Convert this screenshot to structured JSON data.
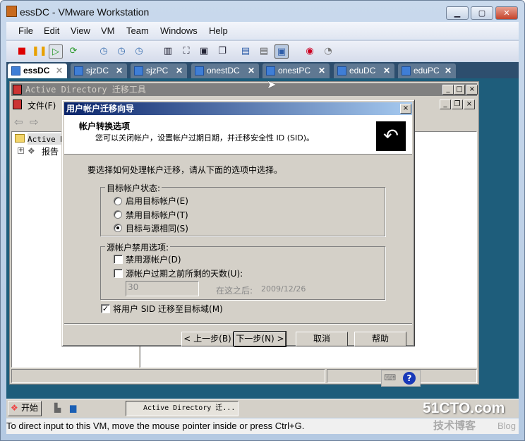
{
  "window": {
    "title": "essDC - VMware Workstation",
    "minimize": "▁",
    "maximize": "▢",
    "close": "✕"
  },
  "menu": [
    "File",
    "Edit",
    "View",
    "VM",
    "Team",
    "Windows",
    "Help"
  ],
  "toolbar_icons": [
    "stop-icon",
    "pause-icon",
    "play-icon",
    "reset-icon",
    "snapshot-icon",
    "revert-snapshot-icon",
    "snapshot-manager-icon",
    "sidebar-icon",
    "quick-switch-icon",
    "fullscreen-icon",
    "unity-icon",
    "summary-icon",
    "console-icon",
    "console-view-icon",
    "record-icon",
    "replay-icon"
  ],
  "tabs": [
    {
      "label": "essDC",
      "active": true
    },
    {
      "label": "sjzDC"
    },
    {
      "label": "sjzPC"
    },
    {
      "label": "onestDC"
    },
    {
      "label": "onestPC"
    },
    {
      "label": "eduDC"
    },
    {
      "label": "eduPC"
    }
  ],
  "tab_close": "✕",
  "ad_window": {
    "title": "Active Directory 迁移工具",
    "menu_file": "文件(F)",
    "tree_root": "Active Directory 迁移工具",
    "tree_child": "报告",
    "expand": "+"
  },
  "dialog": {
    "title": "用户帐户迁移向导",
    "header_title": "帐户转换选项",
    "header_subtitle": "您可以关闭帐户，设置帐户过期日期，并迁移安全性 ID (SID)。",
    "instruction": "要选择如何处理帐户迁移，请从下面的选项中选择。",
    "group1": {
      "label": "目标帐户状态:",
      "options": [
        {
          "label": "启用目标帐户(E)",
          "selected": false
        },
        {
          "label": "禁用目标帐户(T)",
          "selected": false
        },
        {
          "label": "目标与源相同(S)",
          "selected": true
        }
      ]
    },
    "group2": {
      "label": "源帐户禁用选项:",
      "disable_source": {
        "label": "禁用源帐户(D)",
        "checked": false
      },
      "expire_days": {
        "label": "源帐户过期之前所剩的天数(U):",
        "checked": false,
        "value": "30"
      },
      "after_label": "在这之后:",
      "after_date": "2009/12/26"
    },
    "migrate_sid": {
      "label": "将用户 SID 迁移至目标域(M)",
      "checked": true
    },
    "buttons": {
      "back": "< 上一步(B)",
      "next": "下一步(N) >",
      "cancel": "取消",
      "help": "帮助"
    }
  },
  "guest_taskbar": {
    "start": "开始",
    "task": "Active Directory 迁..."
  },
  "status_text": "To direct input to this VM, move the mouse pointer inside or press Ctrl+G.",
  "watermark": {
    "site": "51CTO.com",
    "sub": "技术博客",
    "blog": "Blog"
  },
  "colors": {
    "vm_bg": "#1e5d7b",
    "dialog_title": "#0a246a",
    "tab_bar": "#2d4e6e"
  }
}
